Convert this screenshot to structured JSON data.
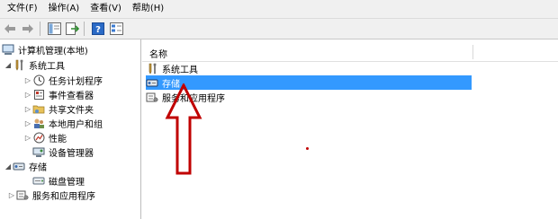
{
  "menubar": {
    "file": "文件(F)",
    "action": "操作(A)",
    "view": "查看(V)",
    "help": "帮助(H)"
  },
  "tree": {
    "root": "计算机管理(本地)",
    "system_tools": "系统工具",
    "task_scheduler": "任务计划程序",
    "event_viewer": "事件查看器",
    "shared_folders": "共享文件夹",
    "local_users": "本地用户和组",
    "performance": "性能",
    "device_manager": "设备管理器",
    "storage": "存储",
    "disk_management": "磁盘管理",
    "services_apps": "服务和应用程序"
  },
  "list": {
    "column_name": "名称",
    "items": [
      "系统工具",
      "存储",
      "服务和应用程序"
    ]
  },
  "colors": {
    "selection": "#3399ff",
    "annotation": "#c00000"
  },
  "icons": [
    "back-arrow-icon",
    "forward-arrow-icon",
    "console-tree-icon",
    "export-icon",
    "help-icon",
    "properties-icon",
    "computer-icon",
    "tools-icon",
    "clock-icon",
    "event-log-icon",
    "shared-folder-icon",
    "users-icon",
    "performance-icon",
    "device-manager-icon",
    "storage-icon",
    "disk-icon",
    "services-icon"
  ]
}
